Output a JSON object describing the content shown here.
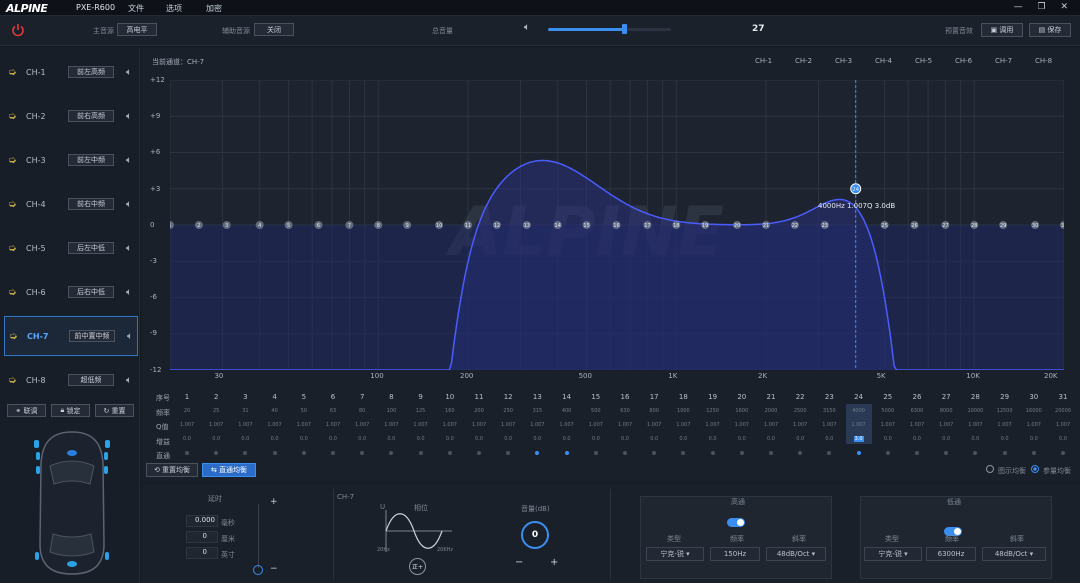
{
  "app": {
    "logo": "ALPINE",
    "model": "PXE-R600",
    "menus": [
      "文件",
      "选项",
      "加密"
    ],
    "window_controls": "— ❐ ✕"
  },
  "toolbar": {
    "main_source_label": "主音源",
    "main_source_value": "高电平",
    "aux_source_label": "辅助音源",
    "aux_source_value": "关闭",
    "master_volume_label": "总音量",
    "master_volume_value": "27",
    "master_volume_fraction": 0.62,
    "preset_label": "预置音效",
    "recall_label": "调用",
    "save_label": "保存"
  },
  "channels": [
    {
      "name": "CH-1",
      "tag": "前左高频"
    },
    {
      "name": "CH-2",
      "tag": "前右高频"
    },
    {
      "name": "CH-3",
      "tag": "前左中频"
    },
    {
      "name": "CH-4",
      "tag": "前右中频"
    },
    {
      "name": "CH-5",
      "tag": "后左中低"
    },
    {
      "name": "CH-6",
      "tag": "后右中低"
    },
    {
      "name": "CH-7",
      "tag": "前中置中频",
      "selected": true
    },
    {
      "name": "CH-8",
      "tag": "超低频"
    }
  ],
  "side_buttons": {
    "link": "联调",
    "lock": "锁定",
    "reset": "重置"
  },
  "eq": {
    "current_channel": "当前通道：CH-7",
    "legend": [
      "CH-1",
      "CH-2",
      "CH-3",
      "CH-4",
      "CH-5",
      "CH-6",
      "CH-7",
      "CH-8"
    ],
    "y_ticks": [
      "+12",
      "+9",
      "+6",
      "+3",
      "0",
      "-3",
      "-6",
      "-9",
      "-12"
    ],
    "x_ticks": [
      "30",
      "100",
      "200",
      "500",
      "1K",
      "2K",
      "5K",
      "10K",
      "20K"
    ],
    "tooltip": "4000Hz  1.007Q  3.0dB",
    "watermark": "ALPINE",
    "row_headers": [
      "序号",
      "频率",
      "Q值",
      "增益",
      "直通"
    ],
    "bands": [
      "1",
      "2",
      "3",
      "4",
      "5",
      "6",
      "7",
      "8",
      "9",
      "10",
      "11",
      "12",
      "13",
      "14",
      "15",
      "16",
      "17",
      "18",
      "19",
      "20",
      "21",
      "22",
      "23",
      "24",
      "25",
      "26",
      "27",
      "28",
      "29",
      "30",
      "31"
    ],
    "highlight_band": 24,
    "freqs": [
      "20",
      "25",
      "31",
      "40",
      "50",
      "63",
      "80",
      "100",
      "125",
      "160",
      "200",
      "250",
      "315",
      "400",
      "500",
      "630",
      "800",
      "1000",
      "1250",
      "1600",
      "2000",
      "2500",
      "3150",
      "4000",
      "5000",
      "6300",
      "8000",
      "10000",
      "12500",
      "16000",
      "20000"
    ],
    "q": "1.007",
    "gains": [
      "0.0",
      "0.0",
      "0.0",
      "0.0",
      "0.0",
      "0.0",
      "0.0",
      "0.0",
      "0.0",
      "0.0",
      "0.0",
      "0.0",
      "0.0",
      "0.0",
      "0.0",
      "0.0",
      "0.0",
      "0.0",
      "0.0",
      "0.0",
      "0.0",
      "0.0",
      "0.0",
      "3.0",
      "0.0",
      "0.0",
      "0.0",
      "0.0",
      "0.0",
      "0.0",
      "0.0"
    ],
    "restore_label": "重置均衡",
    "direct_label": "直通均衡",
    "show_eq_label": "图示均衡",
    "param_eq_label": "参量均衡"
  },
  "bottom": {
    "delay_title": "延时",
    "delay_ms": "0.000",
    "delay_ms_unit": "毫秒",
    "delay_cm": "0",
    "delay_cm_unit": "厘米",
    "delay_in": "0",
    "delay_in_unit": "英寸",
    "ch_label": "CH-7",
    "phase_title": "相位",
    "phase_u": "U",
    "phase_low": "20Hz",
    "phase_high": "20KHz",
    "phase_btn": "正+",
    "gain_title": "音量(dB)",
    "gain_value": "0",
    "hp_title": "高通",
    "lp_title": "低通",
    "type_label": "类型",
    "freq_label": "频率",
    "slope_label": "斜率",
    "hp_type": "宁克-锐",
    "hp_freq": "150Hz",
    "hp_slope": "48dB/Oct",
    "lp_type": "宁克-锐",
    "lp_freq": "6300Hz",
    "lp_slope": "48dB/Oct"
  }
}
